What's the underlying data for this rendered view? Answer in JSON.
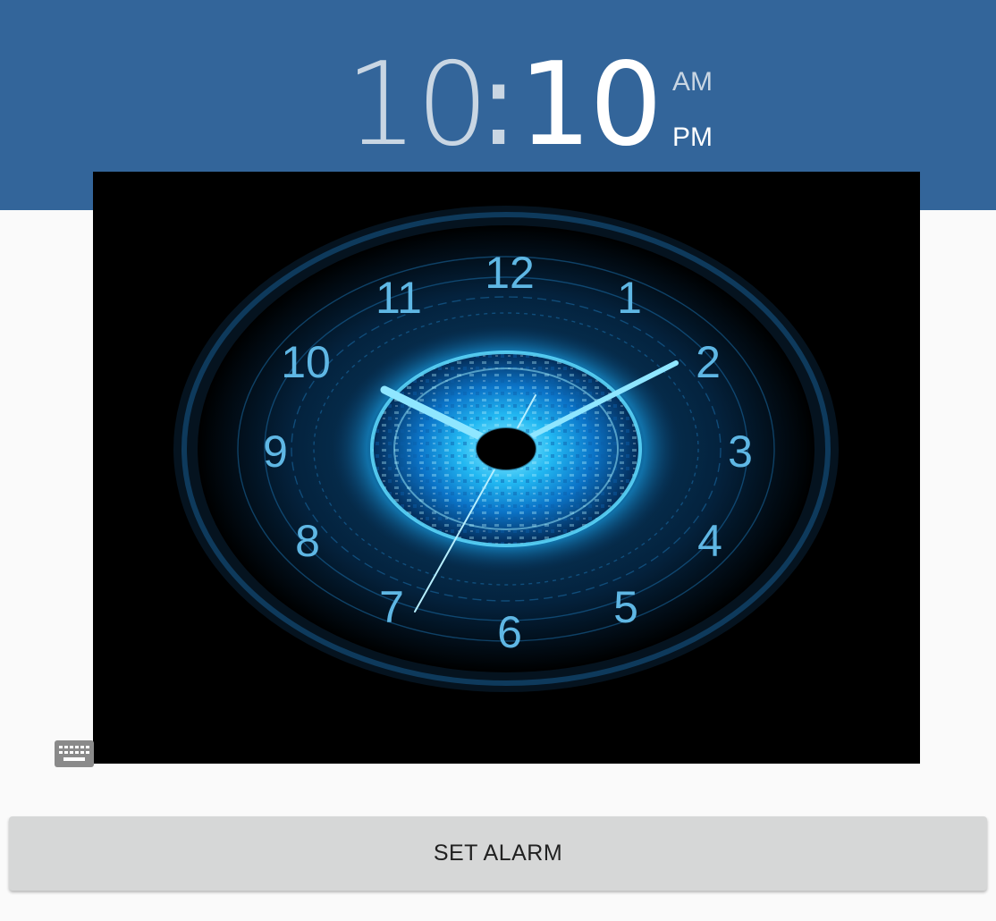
{
  "header": {
    "hour": "10",
    "separator": ":",
    "minute": "10",
    "am_label": "AM",
    "pm_label": "PM",
    "selected_period": "PM",
    "color": "#33659a"
  },
  "clock": {
    "numbers": [
      "12",
      "1",
      "2",
      "3",
      "4",
      "5",
      "6",
      "7",
      "8",
      "9",
      "10",
      "11"
    ],
    "accent_color": "#39c6f5"
  },
  "keyboard_icon": {
    "icon": "keyboard-icon"
  },
  "action": {
    "set_alarm_label": "SET ALARM"
  }
}
